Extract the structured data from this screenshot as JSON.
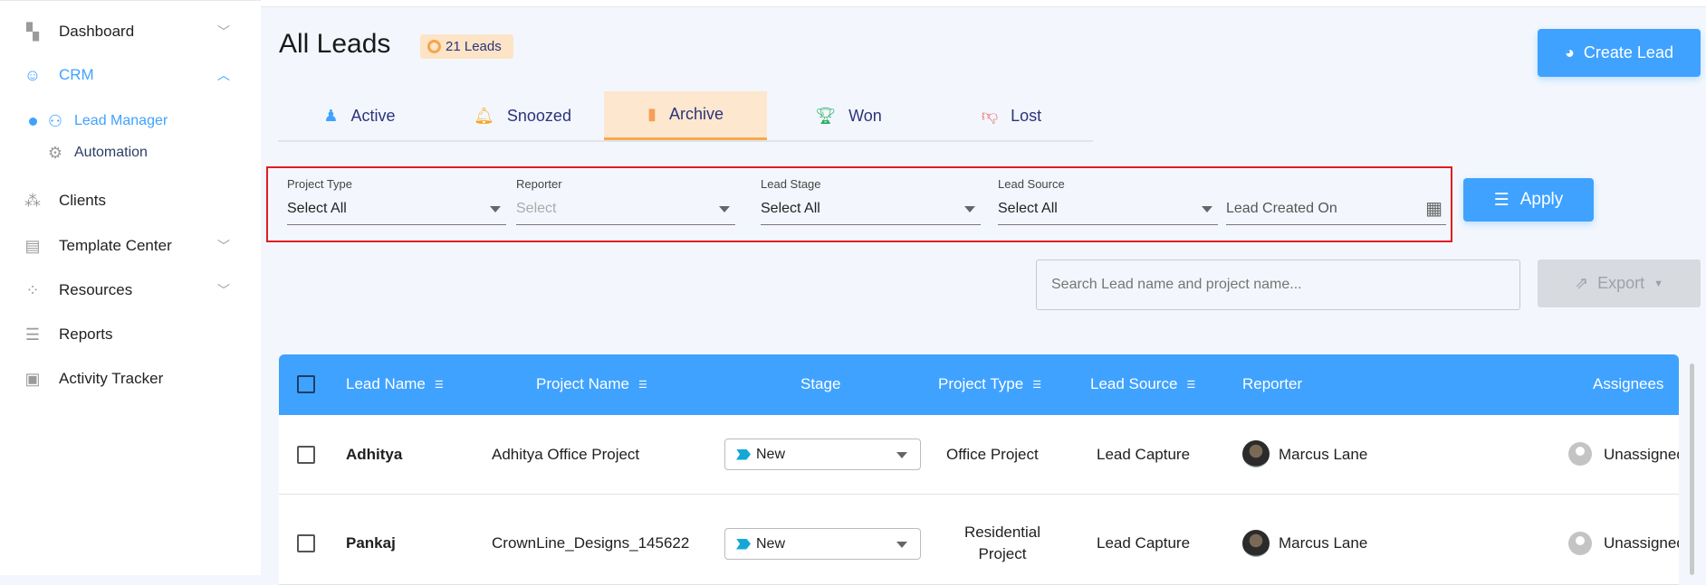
{
  "sidebar": {
    "items": [
      {
        "label": "Dashboard",
        "icon": "dashboard-icon"
      },
      {
        "label": "CRM",
        "icon": "crm-icon"
      },
      {
        "label": "Lead Manager",
        "icon": "lead-manager-icon"
      },
      {
        "label": "Automation",
        "icon": "automation-icon"
      },
      {
        "label": "Clients",
        "icon": "clients-icon"
      },
      {
        "label": "Template Center",
        "icon": "template-icon"
      },
      {
        "label": "Resources",
        "icon": "resources-icon"
      },
      {
        "label": "Reports",
        "icon": "reports-icon"
      },
      {
        "label": "Activity Tracker",
        "icon": "activity-icon"
      }
    ]
  },
  "header": {
    "title": "All Leads",
    "badge": "21 Leads",
    "create_label": "Create Lead"
  },
  "tabs": [
    {
      "label": "Active"
    },
    {
      "label": "Snoozed"
    },
    {
      "label": "Archive"
    },
    {
      "label": "Won"
    },
    {
      "label": "Lost"
    }
  ],
  "filters": {
    "project_type": {
      "label": "Project Type",
      "value": "Select All"
    },
    "reporter": {
      "label": "Reporter",
      "placeholder": "Select"
    },
    "lead_stage": {
      "label": "Lead Stage",
      "value": "Select All"
    },
    "lead_source": {
      "label": "Lead Source",
      "value": "Select All"
    },
    "lead_created": {
      "placeholder": "Lead Created On"
    },
    "apply_label": "Apply"
  },
  "search": {
    "placeholder": "Search Lead name and project name..."
  },
  "export_label": "Export",
  "table": {
    "headers": [
      "Lead Name",
      "Project Name",
      "Stage",
      "Project Type",
      "Lead Source",
      "Reporter",
      "Assignees"
    ],
    "rows": [
      {
        "lead": "Adhitya",
        "project": "Adhitya Office Project",
        "stage": "New",
        "type": "Office Project",
        "type2": "",
        "source": "Lead Capture",
        "reporter": "Marcus Lane",
        "assignee": "Unassigned"
      },
      {
        "lead": "Pankaj",
        "project": "CrownLine_Designs_145622",
        "stage": "New",
        "type": "Residential",
        "type2": "Project",
        "source": "Lead Capture",
        "reporter": "Marcus Lane",
        "assignee": "Unassigned"
      }
    ]
  },
  "colors": {
    "accent": "#3fa2ff",
    "tab_selected": "#fde7cf",
    "highlight": "#e31b23"
  }
}
